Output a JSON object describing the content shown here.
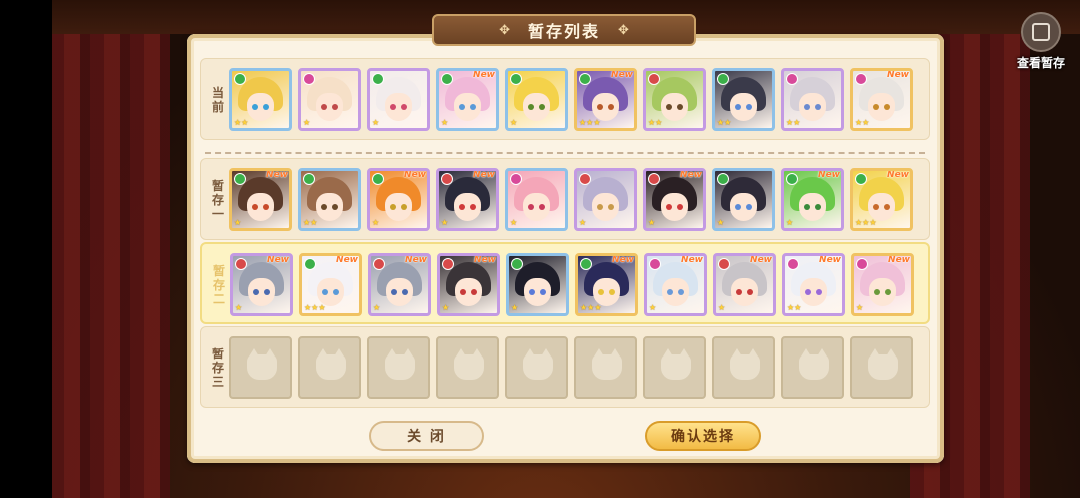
{
  "header": {
    "title": "暂存列表",
    "view_stash_label": "查看暂存"
  },
  "rows": [
    {
      "label": [
        "当",
        "前"
      ],
      "selected": false,
      "cards": [
        {
          "hair": "#f0c84a",
          "eye": "#3aa0d8",
          "border": "r-blue",
          "el": "#3cb04a",
          "stars": "★★",
          "new": ""
        },
        {
          "hair": "#f6e0c8",
          "eye": "#c04a4a",
          "border": "r-purple",
          "el": "#d84a9a",
          "stars": "★",
          "new": ""
        },
        {
          "hair": "#f2ecec",
          "eye": "#d04a6a",
          "border": "r-purple",
          "el": "#3cb04a",
          "stars": "★",
          "new": ""
        },
        {
          "hair": "#f0b8d8",
          "eye": "#5a9ad8",
          "border": "r-blue",
          "el": "#3cb04a",
          "stars": "★",
          "new": "New"
        },
        {
          "hair": "#f4d24a",
          "eye": "#5a8a2a",
          "border": "r-blue",
          "el": "#3cb04a",
          "stars": "★",
          "new": ""
        },
        {
          "hair": "#7a5ab0",
          "eye": "#b85a2a",
          "border": "r-gold",
          "el": "#3cb04a",
          "stars": "★★★",
          "new": "New"
        },
        {
          "hair": "#a6c860",
          "eye": "#6a4a2a",
          "border": "r-purple",
          "el": "#d84a4a",
          "stars": "★★",
          "new": ""
        },
        {
          "hair": "#3a3a4a",
          "eye": "#5a8ad8",
          "border": "r-blue",
          "el": "#3cb04a",
          "stars": "★★",
          "new": ""
        },
        {
          "hair": "#d6d0d8",
          "eye": "#6a8ad0",
          "border": "r-purple",
          "el": "#d84a9a",
          "stars": "★★",
          "new": ""
        },
        {
          "hair": "#e8e4e0",
          "eye": "#c88a2a",
          "border": "r-gold",
          "el": "#d84a9a",
          "stars": "★★",
          "new": "New"
        }
      ]
    },
    {
      "label": [
        "暂",
        "存",
        "一"
      ],
      "selected": false,
      "cards": [
        {
          "hair": "#5a3a2a",
          "eye": "#c84a2a",
          "border": "r-gold",
          "el": "#3cb04a",
          "stars": "★",
          "new": "New"
        },
        {
          "hair": "#9a6a4a",
          "eye": "#6a4a2a",
          "border": "r-blue",
          "el": "#3cb04a",
          "stars": "★★",
          "new": ""
        },
        {
          "hair": "#f08a2a",
          "eye": "#c8a02a",
          "border": "r-purple",
          "el": "#3cb04a",
          "stars": "★",
          "new": "New"
        },
        {
          "hair": "#2a2a3a",
          "eye": "#d03a3a",
          "border": "r-purple",
          "el": "#d84a4a",
          "stars": "★",
          "new": "New"
        },
        {
          "hair": "#f4a6b8",
          "eye": "#c83a5a",
          "border": "r-blue",
          "el": "#d84a9a",
          "stars": "★",
          "new": ""
        },
        {
          "hair": "#b8b0d0",
          "eye": "#c89a4a",
          "border": "r-purple",
          "el": "#d84a4a",
          "stars": "★",
          "new": ""
        },
        {
          "hair": "#2a2024",
          "eye": "#d03a3a",
          "border": "r-purple",
          "el": "#d84a4a",
          "stars": "★",
          "new": "New"
        },
        {
          "hair": "#2e2a38",
          "eye": "#5a8ad8",
          "border": "r-blue",
          "el": "#3cb04a",
          "stars": "★",
          "new": ""
        },
        {
          "hair": "#6ac84a",
          "eye": "#3a8a3a",
          "border": "r-purple",
          "el": "#3cb04a",
          "stars": "★",
          "new": "New"
        },
        {
          "hair": "#f2d24a",
          "eye": "#c86a2a",
          "border": "r-gold",
          "el": "#3cb04a",
          "stars": "★★★",
          "new": "New"
        }
      ]
    },
    {
      "label": [
        "暂",
        "存",
        "二"
      ],
      "selected": true,
      "cards": [
        {
          "hair": "#9aa0b0",
          "eye": "#4a6ab0",
          "border": "r-purple",
          "el": "#d84a4a",
          "stars": "★",
          "new": "New"
        },
        {
          "hair": "#f4f2f6",
          "eye": "#5a9ad8",
          "border": "r-gold",
          "el": "#3cb04a",
          "stars": "★★★",
          "new": "New"
        },
        {
          "hair": "#9aa0b0",
          "eye": "#4a6ab0",
          "border": "r-purple",
          "el": "#d84a4a",
          "stars": "★",
          "new": "New"
        },
        {
          "hair": "#3a3438",
          "eye": "#c83a3a",
          "border": "r-purple",
          "el": "#d84a4a",
          "stars": "★",
          "new": "New"
        },
        {
          "hair": "#1e1e2a",
          "eye": "#5a7ad8",
          "border": "r-blue",
          "el": "#3cb04a",
          "stars": "★",
          "new": ""
        },
        {
          "hair": "#2a2a5a",
          "eye": "#e8c23a",
          "border": "r-gold",
          "el": "#3cb04a",
          "stars": "★★★",
          "new": "New"
        },
        {
          "hair": "#d8e4f0",
          "eye": "#6a9ad8",
          "border": "r-purple",
          "el": "#d84a9a",
          "stars": "★",
          "new": "New"
        },
        {
          "hair": "#c8c4c8",
          "eye": "#c83a3a",
          "border": "r-purple",
          "el": "#d84a4a",
          "stars": "★",
          "new": "New"
        },
        {
          "hair": "#eef0f6",
          "eye": "#9a6ad8",
          "border": "r-purple",
          "el": "#d84a9a",
          "stars": "★★",
          "new": "New"
        },
        {
          "hair": "#f0c0d8",
          "eye": "#6a9a3a",
          "border": "r-gold",
          "el": "#d84a9a",
          "stars": "★",
          "new": "New"
        }
      ]
    },
    {
      "label": [
        "暂",
        "存",
        "三"
      ],
      "selected": false,
      "empty_slots": 10
    }
  ],
  "buttons": {
    "close": "关 闭",
    "confirm": "确认选择"
  }
}
